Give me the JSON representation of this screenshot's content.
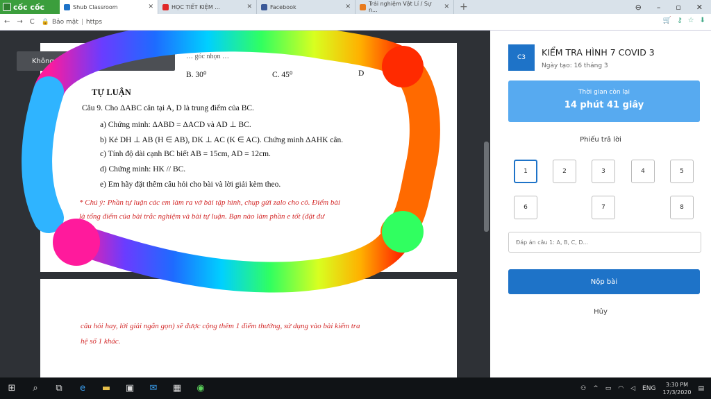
{
  "browser": {
    "brand": "cốc cốc",
    "tabs": [
      {
        "label": "Shub Classroom",
        "icon_color": "#1e73c8"
      },
      {
        "label": "HỌC TIẾT KIỆM ...",
        "icon_color": "#e02828"
      },
      {
        "label": "Facebook",
        "icon_color": "#3b5998"
      },
      {
        "label": "Trải nghiệm Vật Lí / Sự n...",
        "icon_color": "#e87b1e"
      }
    ],
    "address_prefix": "Bảo mật",
    "address_url": "https"
  },
  "document": {
    "toolbar_text": "Không",
    "top_options": [
      "B. 30⁰",
      "C. 45⁰",
      "D"
    ],
    "top_partial": "… góc nhọn …",
    "section_title": "TỰ LUẬN",
    "question_intro": "Câu 9. Cho ΔABC cân tại A, D là trung điểm của BC.",
    "parts": [
      "a) Chứng minh: ΔABD = ΔACD và AD ⊥ BC.",
      "b) Kẻ DH ⊥ AB (H ∈ AB), DK ⊥ AC (K ∈ AC). Chứng minh ΔAHK cân.",
      "c) Tính độ dài cạnh BC biết AB = 15cm, AD = 12cm.",
      "d) Chứng minh: HK // BC.",
      "e) Em hãy đặt thêm câu hỏi cho bài và lời giải kèm theo."
    ],
    "note_line1": "* Chú ý: Phần tự luận các em làm ra vở bài tập hình, chụp gửi zalo cho cô. Điểm bài",
    "note_line2": "là tổng điểm của bài trắc nghiệm và bài tự luận. Bạn nào làm phần e tốt (đặt đư",
    "page2_line1": "câu hỏi hay, lời giải ngắn gọn) sẽ được cộng thêm 1 điểm thưởng, sử dụng vào bài kiểm tra",
    "page2_line2": "hệ số 1 khác."
  },
  "quiz": {
    "avatar": "C3",
    "title": "KIỂM TRA HÌNH 7 COVID 3",
    "date": "Ngày tạo: 16 tháng 3",
    "timer_label": "Thời gian còn lại",
    "timer_value": "14 phút 41 giây",
    "answer_sheet_title": "Phiếu trả lời",
    "questions": [
      "1",
      "2",
      "3",
      "4",
      "5",
      "6",
      "7",
      "8"
    ],
    "answer_placeholder": "Đáp án câu 1: A, B, C, D...",
    "submit_label": "Nộp bài",
    "cancel_label": "Hủy"
  },
  "taskbar": {
    "language": "ENG",
    "time": "3:30 PM",
    "date": "17/3/2020"
  }
}
